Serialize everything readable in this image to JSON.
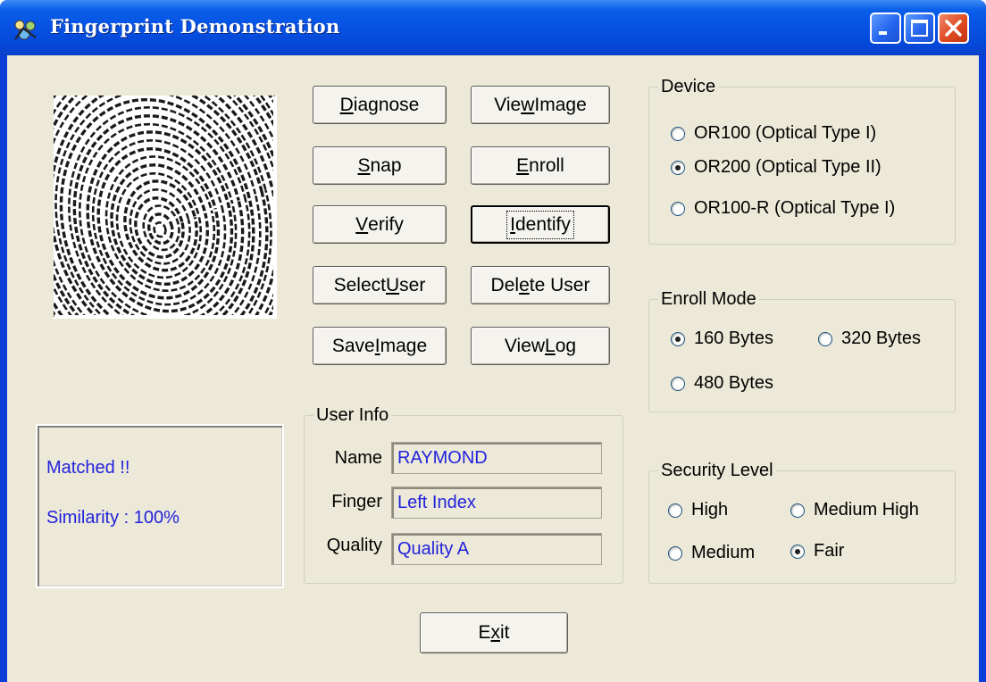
{
  "window": {
    "title": "Fingerprint Demonstration",
    "controls": [
      "minimize-icon",
      "maximize-icon",
      "close-icon"
    ]
  },
  "buttons": {
    "diagnose": {
      "pre": "",
      "u": "D",
      "post": "iagnose"
    },
    "view_image": {
      "pre": "Vie",
      "u": "w",
      "post": " Image"
    },
    "snap": {
      "pre": "",
      "u": "S",
      "post": "nap"
    },
    "enroll": {
      "pre": "",
      "u": "E",
      "post": "nroll"
    },
    "verify": {
      "pre": "",
      "u": "V",
      "post": "erify"
    },
    "identify": {
      "pre": "",
      "u": "I",
      "post": "dentify"
    },
    "select_user": {
      "pre": "Select ",
      "u": "U",
      "post": "ser"
    },
    "delete_user": {
      "pre": "Del",
      "u": "e",
      "post": "te User"
    },
    "save_image": {
      "pre": "Save ",
      "u": "I",
      "post": "mage"
    },
    "view_log": {
      "pre": "View ",
      "u": "L",
      "post": "og"
    },
    "exit": {
      "pre": "E",
      "u": "x",
      "post": "it"
    }
  },
  "status": {
    "line1": "Matched !!",
    "line2": "Similarity : 100%"
  },
  "user_info": {
    "legend": "User Info",
    "name_label": "Name",
    "name_value": "RAYMOND",
    "finger_label": "Finger",
    "finger_value": "Left Index",
    "quality_label": "Quality",
    "quality_value": "Quality A"
  },
  "device": {
    "legend": "Device",
    "options": [
      {
        "label": "OR100 (Optical Type I)",
        "selected": false
      },
      {
        "label": "OR200 (Optical Type II)",
        "selected": true
      },
      {
        "label": "OR100-R (Optical Type I)",
        "selected": false
      }
    ]
  },
  "enroll_mode": {
    "legend": "Enroll Mode",
    "options": [
      {
        "label": "160 Bytes",
        "selected": true
      },
      {
        "label": "320 Bytes",
        "selected": false
      },
      {
        "label": "480 Bytes",
        "selected": false
      }
    ]
  },
  "security_level": {
    "legend": "Security Level",
    "options": [
      {
        "label": "High",
        "selected": false
      },
      {
        "label": "Medium High",
        "selected": false
      },
      {
        "label": "Medium",
        "selected": false
      },
      {
        "label": "Fair",
        "selected": true
      }
    ]
  },
  "colors": {
    "titlebar": "#0753e4",
    "client": "#ece9d8",
    "status_text": "#2222dd"
  },
  "icons": {
    "app": "fingerprint-app-icon",
    "fingerprint_image": "fingerprint-image"
  }
}
